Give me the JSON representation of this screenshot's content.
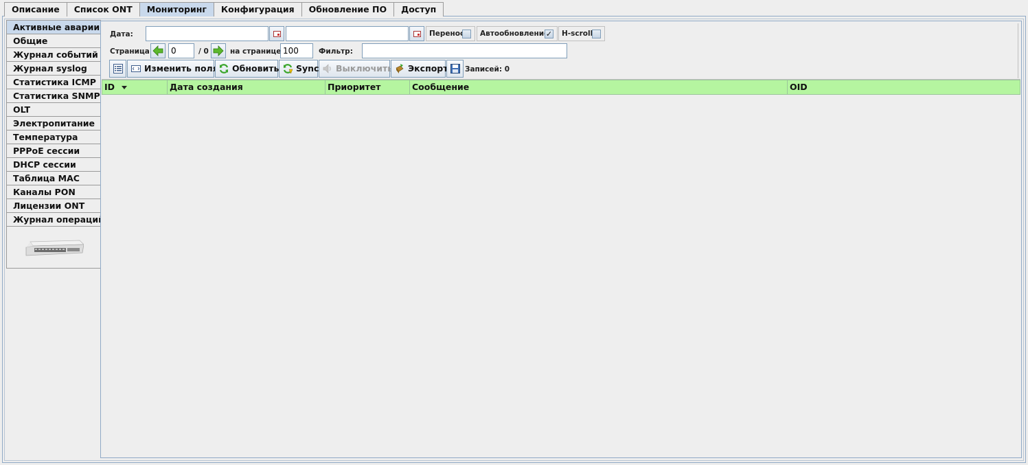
{
  "top_tabs": [
    "Описание",
    "Список ONT",
    "Мониторинг",
    "Конфигурация",
    "Обновление ПО",
    "Доступ"
  ],
  "active_top_tab": "Мониторинг",
  "side_tabs": [
    "Активные аварии",
    "Общие",
    "Журнал событий",
    "Журнал syslog",
    "Статистика ICMP",
    "Статистика SNMP",
    "OLT",
    "Электропитание",
    "Температура",
    "PPPoE сессии",
    "DHCP сессии",
    "Таблица MAC",
    "Каналы PON",
    "Лицензии ONT",
    "Журнал операций"
  ],
  "active_side_tab": "Активные аварии",
  "filters": {
    "date_label": "Дата:",
    "date_from": "",
    "date_to": "",
    "wrap_label": "Перенос",
    "wrap_checked": false,
    "autorefresh_label": "Автообновление",
    "autorefresh_checked": true,
    "hscroll_label": "H-scroll",
    "hscroll_checked": false,
    "page_label": "Страница:",
    "page_value": "0",
    "page_total": "/ 0",
    "per_page_label": "на странице:",
    "per_page_value": "100",
    "filter_label": "Фильтр:",
    "filter_value": ""
  },
  "toolbar": {
    "edit_fields": "Изменить поля",
    "refresh": "Обновить",
    "sync": "Sync",
    "disable": "Выключить",
    "export": "Экспорт",
    "records": "Записей: 0"
  },
  "table": {
    "columns": [
      "ID",
      "Дата создания",
      "Приоритет",
      "Сообщение",
      "OID"
    ],
    "sorted_column": "ID",
    "rows": []
  },
  "colors": {
    "header_green": "#b5f5a0",
    "active_tab": "#c9d9ec"
  }
}
